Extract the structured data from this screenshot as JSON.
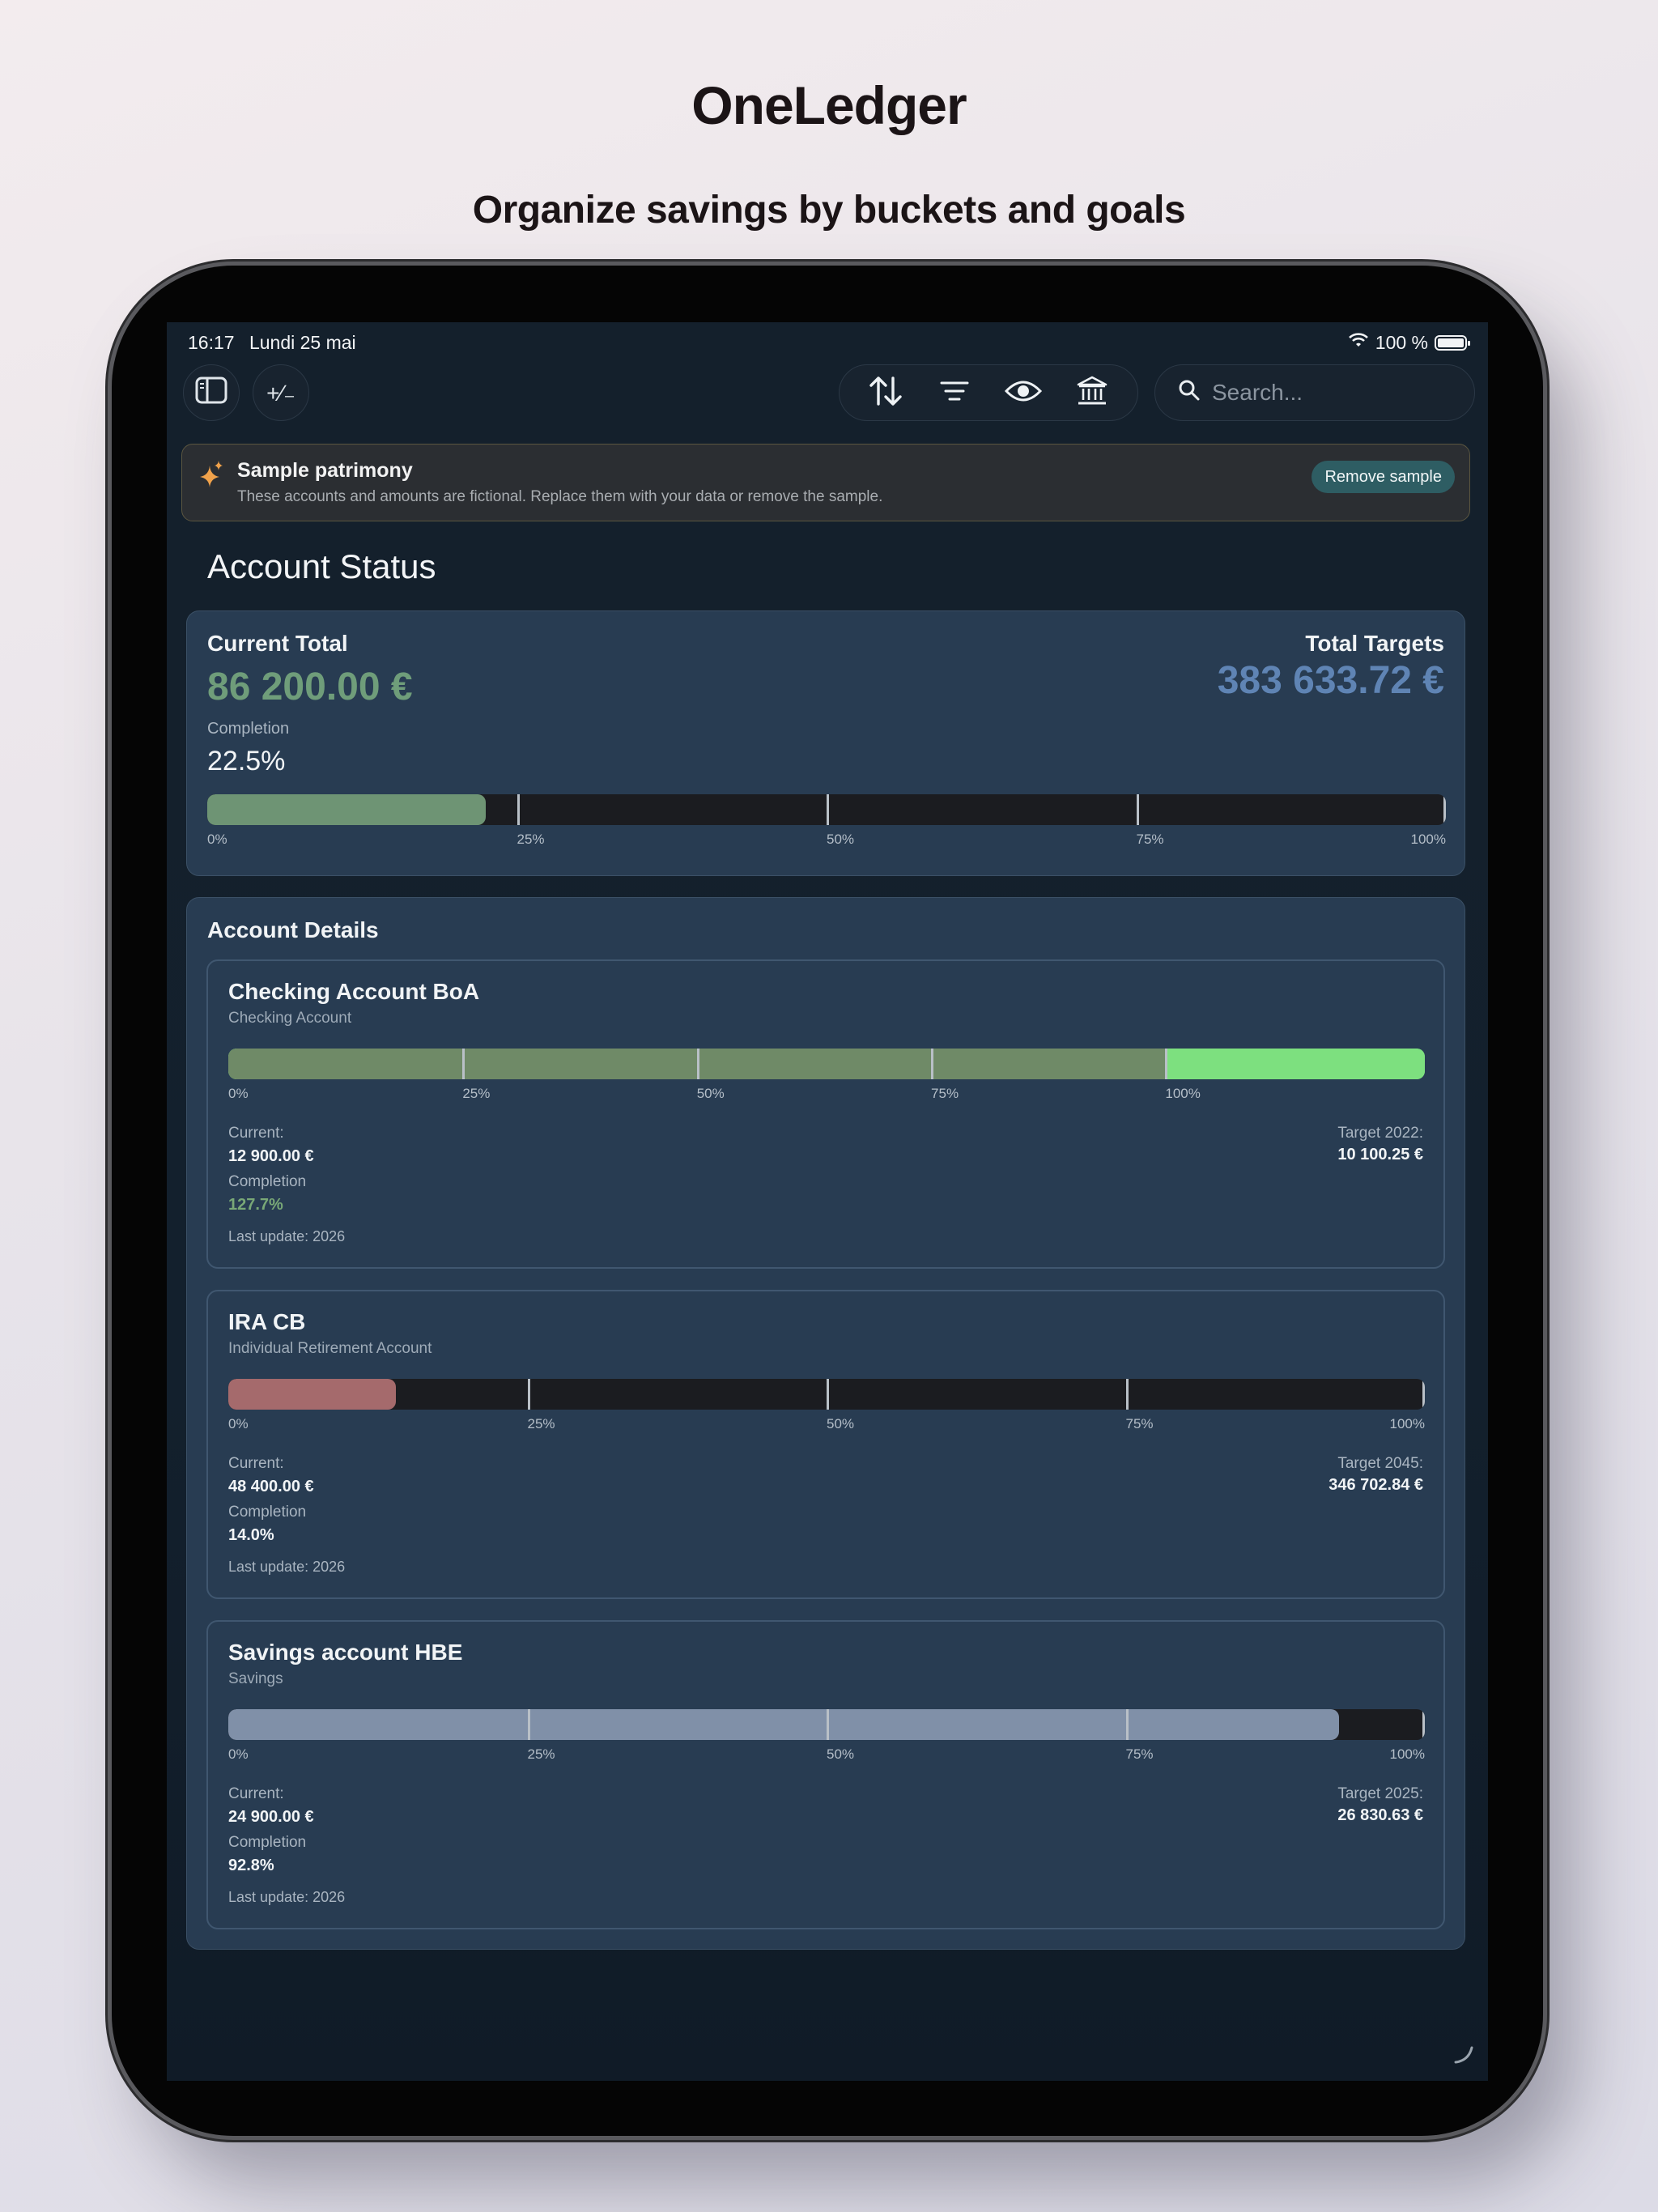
{
  "marketing": {
    "title": "OneLedger",
    "subtitle": "Organize savings by buckets and goals"
  },
  "statusbar": {
    "time": "16:17",
    "date": "Lundi 25 mai",
    "battery_text": "100 %"
  },
  "toolbar": {
    "sidebar_icon": "sidebar-icon",
    "plusminus_label": "+∕₋",
    "tools": [
      "sort-arrows-icon",
      "filter-lines-icon",
      "eye-icon",
      "bank-icon"
    ],
    "search_placeholder": "Search..."
  },
  "banner": {
    "title": "Sample patrimony",
    "description": "These accounts and amounts are fictional. Replace them with your data or remove the sample.",
    "button": "Remove sample"
  },
  "account_status": {
    "heading": "Account Status",
    "current_total_label": "Current Total",
    "current_total": "86 200.00 €",
    "completion_label": "Completion",
    "completion": "22.5%",
    "completion_fraction": 0.225,
    "total_targets_label": "Total Targets",
    "total_targets": "383 633.72 €",
    "axis": [
      "0%",
      "25%",
      "50%",
      "75%",
      "100%"
    ]
  },
  "account_details": {
    "heading": "Account Details",
    "current_label": "Current:",
    "completion_label": "Completion",
    "accounts": [
      {
        "name": "Checking Account BoA",
        "type": "Checking Account",
        "current": "12 900.00 €",
        "completion": "127.7%",
        "completion_fraction": 1.277,
        "target_label": "Target 2022:",
        "target": "10 100.25 €",
        "last_update": "Last update: 2026",
        "fill_color": "#6f8a67",
        "over_color": "#7de07f",
        "completion_color": "#79a877"
      },
      {
        "name": "IRA CB",
        "type": "Individual Retirement Account",
        "current": "48 400.00 €",
        "completion": "14.0%",
        "completion_fraction": 0.14,
        "target_label": "Target 2045:",
        "target": "346 702.84 €",
        "last_update": "Last update: 2026",
        "fill_color": "#a56a6c",
        "completion_color": "#f1f4f6"
      },
      {
        "name": "Savings account HBE",
        "type": "Savings",
        "current": "24 900.00 €",
        "completion": "92.8%",
        "completion_fraction": 0.928,
        "target_label": "Target 2025:",
        "target": "26 830.63 €",
        "last_update": "Last update: 2026",
        "fill_color": "#8090a8",
        "completion_color": "#f1f4f6"
      }
    ]
  },
  "colors": {
    "total_green": "#6f9d7a",
    "targets_blue": "#5f84b4",
    "summary_fill": "#6e9474",
    "card_bg": "#283c52"
  }
}
